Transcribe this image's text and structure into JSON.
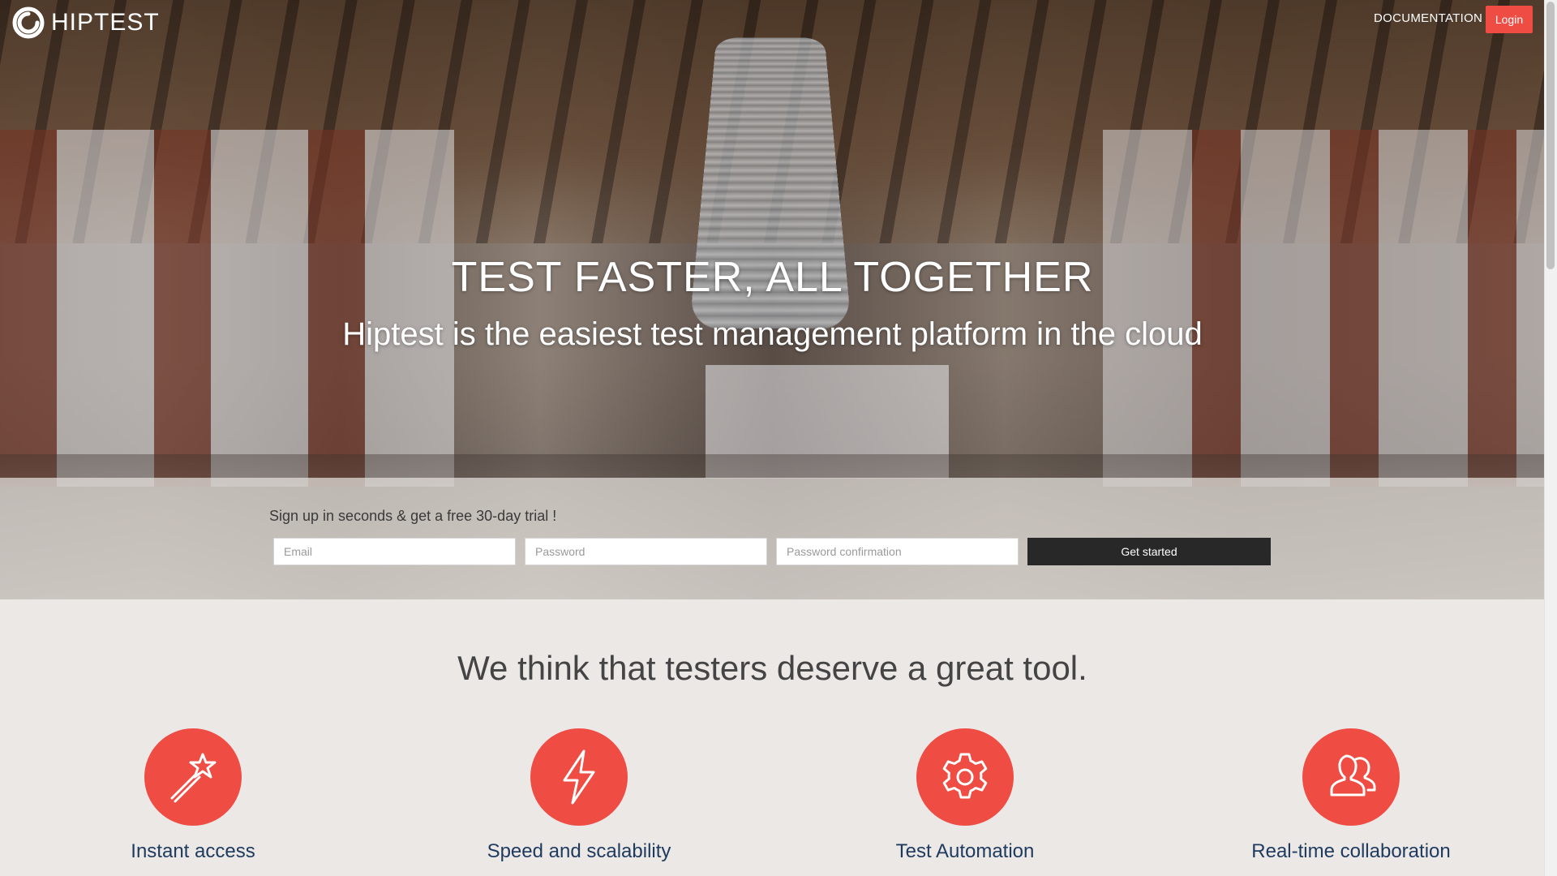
{
  "brand": {
    "name": "HIPTEST",
    "accent_color": "#ef4c44",
    "logo_icon": "hiptest-logo-icon"
  },
  "nav": {
    "documentation_label": "DOCUMENTATION",
    "login_label": "Login"
  },
  "hero": {
    "title": "TEST FASTER, ALL TOGETHER",
    "subtitle": "Hiptest is the easiest test management platform in the cloud"
  },
  "signup": {
    "prompt": "Sign up in seconds & get a free 30-day trial !",
    "email_placeholder": "Email",
    "password_placeholder": "Password",
    "password_confirmation_placeholder": "Password confirmation",
    "submit_label": "Get started"
  },
  "features": {
    "heading": "We think that testers deserve a great tool.",
    "items": [
      {
        "icon": "magic-wand-icon",
        "title": "Instant access"
      },
      {
        "icon": "lightning-bolt-icon",
        "title": "Speed and scalability"
      },
      {
        "icon": "gear-icon",
        "title": "Test Automation"
      },
      {
        "icon": "users-icon",
        "title": "Real-time collaboration"
      }
    ]
  }
}
